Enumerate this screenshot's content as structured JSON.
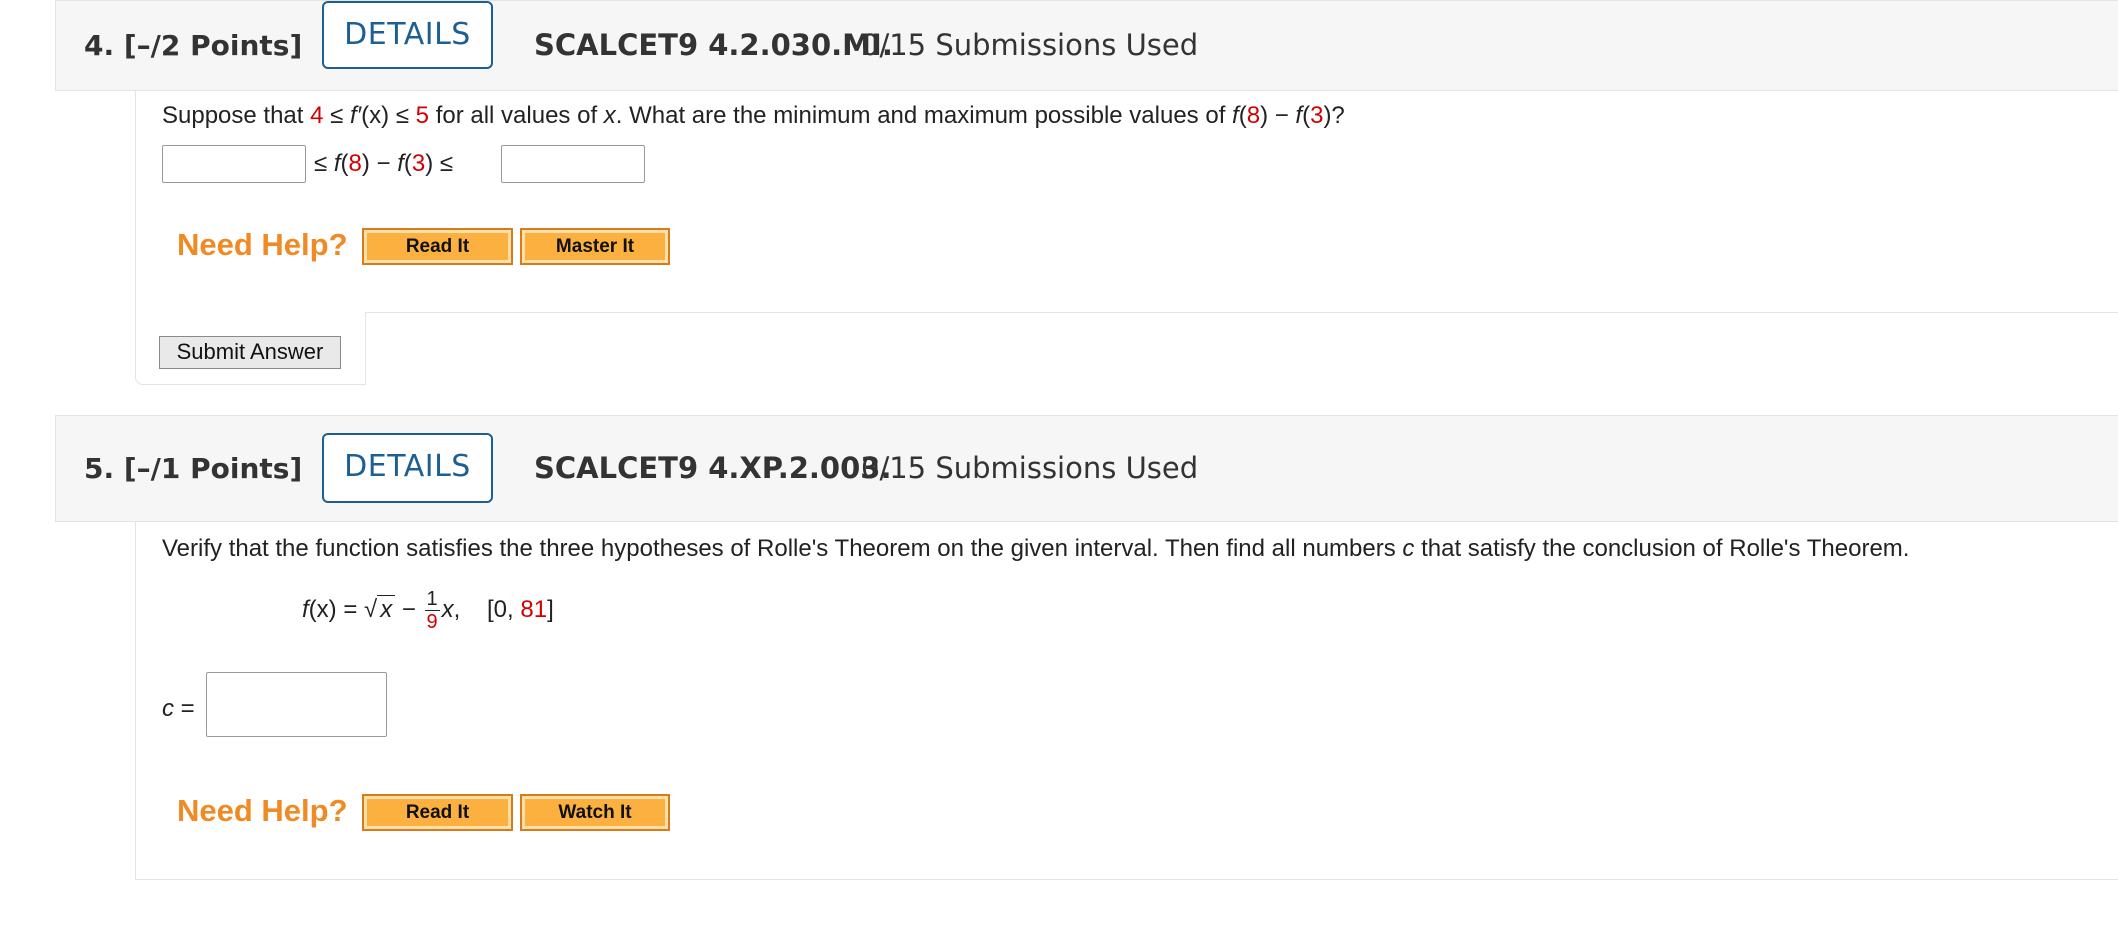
{
  "q4": {
    "number": "4.",
    "points": "[–/2 Points]",
    "details_label": "DETAILS",
    "code": "SCALCET9 4.2.030.MI.",
    "submissions": "0/15 Submissions Used",
    "text_pre": "Suppose that ",
    "lower": "4",
    "le1": " ≤ ",
    "fprime": "f′",
    "fprime_arg": "(x)",
    "le2": " ≤ ",
    "upper": "5",
    "text_mid": " for all values of ",
    "xvar": "x",
    "text_q": ". What are the minimum and maximum possible values of ",
    "f1": "f",
    "a8": "8",
    "minus": ") − ",
    "f2": "f",
    "a3": "3",
    "end": ")?",
    "ineq_le_a": "≤ ",
    "ineq_f8": "f",
    "ineq_8": "8",
    "ineq_minus": ") − ",
    "ineq_f3": "f",
    "ineq_3": "3",
    "ineq_le_b": ") ≤",
    "need_help": "Need Help?",
    "read_it": "Read It",
    "master_it": "Master It",
    "submit": "Submit Answer"
  },
  "q5": {
    "number": "5.",
    "points": "[–/1 Points]",
    "details_label": "DETAILS",
    "code": "SCALCET9 4.XP.2.003.",
    "submissions": "0/15 Submissions Used",
    "text_pre": "Verify that the function satisfies the three hypotheses of Rolle's Theorem on the given interval. Then find all numbers ",
    "cvar": "c",
    "text_post": " that satisfy the conclusion of Rolle's Theorem.",
    "fx": "f",
    "fx_arg": "(x)",
    "eq": " = ",
    "sqrt_var": "x",
    "minus": " − ",
    "frac_num": "1",
    "frac_den": "9",
    "x_after": "x",
    "comma": ",",
    "interval_open": "[0, ",
    "interval_end": "81",
    "interval_close": "]",
    "c_label": "c",
    "c_eq": " =",
    "need_help": "Need Help?",
    "read_it": "Read It",
    "watch_it": "Watch It"
  }
}
